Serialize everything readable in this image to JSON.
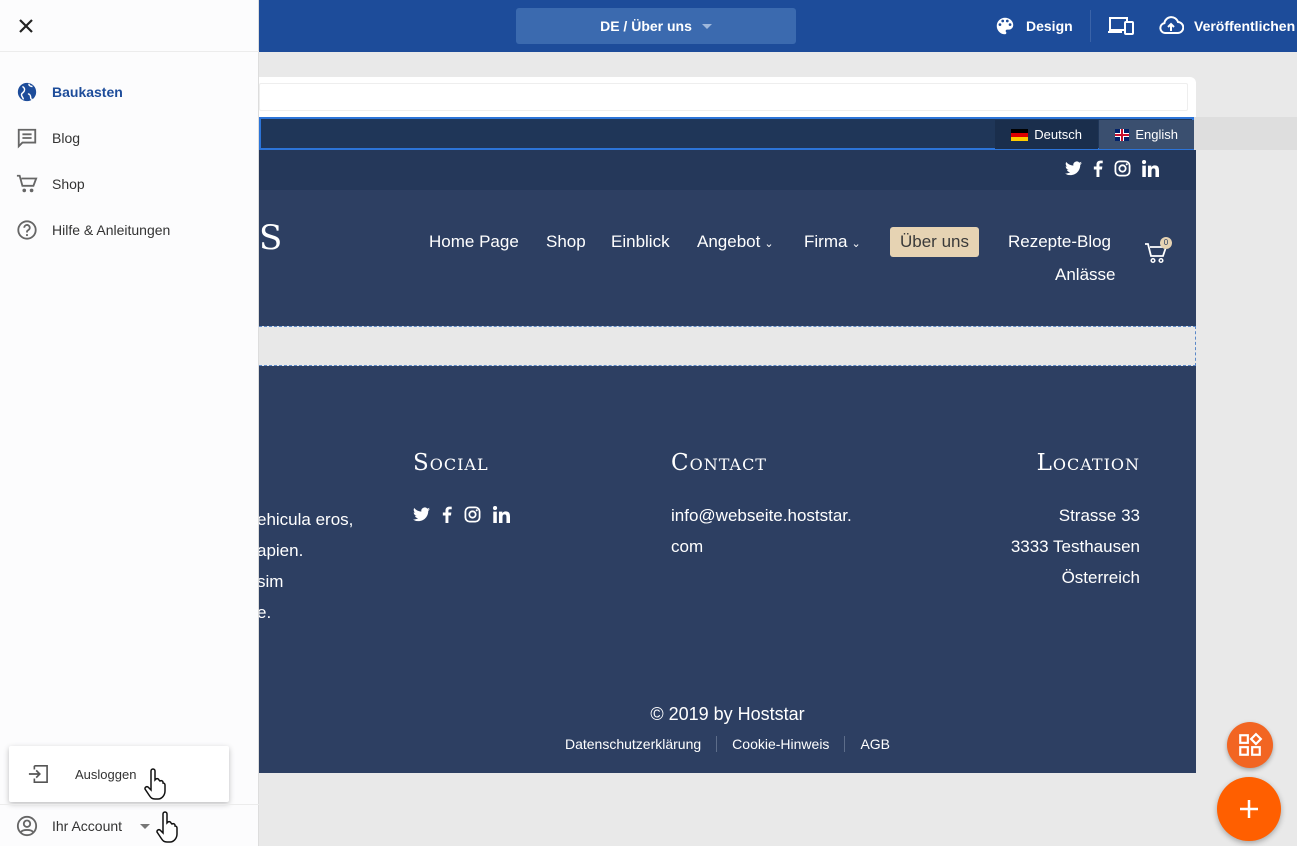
{
  "topbar": {
    "page_selector": "DE / Über uns",
    "design_label": "Design",
    "publish_label": "Veröffentlichen"
  },
  "site": {
    "languages": [
      "Deutsch",
      "English"
    ],
    "logo_fragment": "S",
    "nav": [
      "Home Page",
      "Shop",
      "Einblick",
      "Angebot",
      "Firma",
      "Über uns",
      "Rezepte-Blog",
      "Anlässe"
    ],
    "cart_count": "0",
    "footer": {
      "social_heading": "Social",
      "contact_heading": "Contact",
      "location_heading": "Location",
      "about_lines": [
        "ehicula eros,",
        "apien.",
        "sim",
        "e."
      ],
      "contact_lines": [
        "info@webseite.hoststar.",
        "com"
      ],
      "location_lines": [
        "Strasse 33",
        "3333 Testhausen",
        "Österreich"
      ],
      "copyright": "© 2019 by Hoststar",
      "links": [
        "Datenschutzerklärung",
        "Cookie-Hinweis",
        "AGB"
      ]
    }
  },
  "sidebar": {
    "items": [
      {
        "label": "Baukasten",
        "icon": "globe-icon"
      },
      {
        "label": "Blog",
        "icon": "blog-icon"
      },
      {
        "label": "Shop",
        "icon": "cart-icon"
      },
      {
        "label": "Hilfe & Anleitungen",
        "icon": "help-icon"
      }
    ],
    "logout_label": "Ausloggen",
    "account_label": "Ihr Account"
  },
  "colors": {
    "topbar": "#1d4c9a",
    "site_navy": "#2d3f62",
    "accent_beige": "#e6d3b3",
    "fab_orange": "#ff5f00"
  }
}
